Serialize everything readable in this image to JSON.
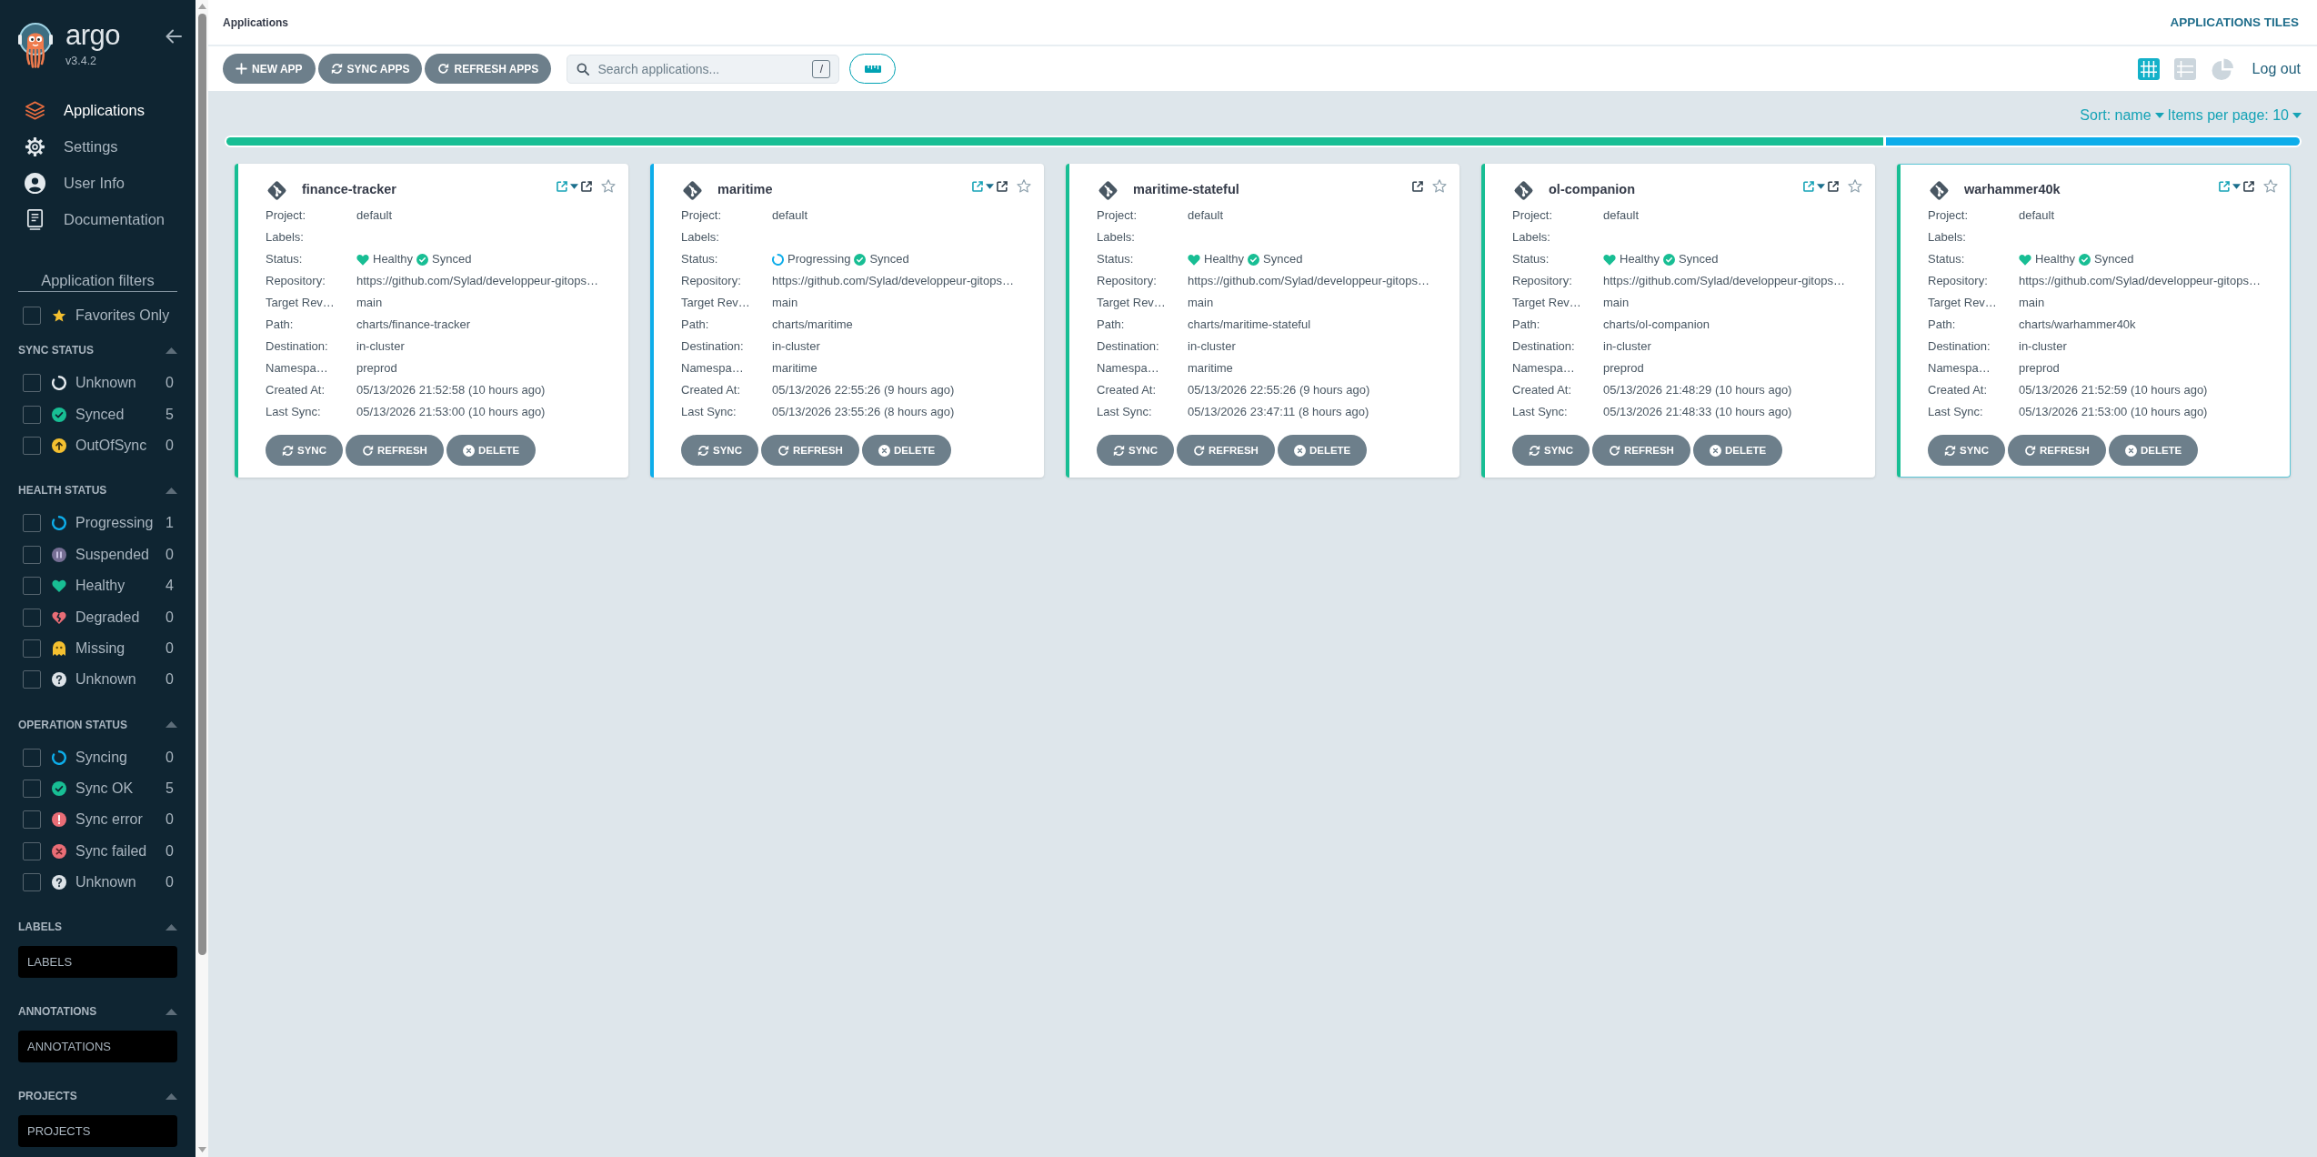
{
  "sidebar": {
    "logo": {
      "name": "argo",
      "version": "v3.4.2"
    },
    "nav": [
      {
        "kind": "applications",
        "label": "Applications",
        "selected": true
      },
      {
        "kind": "settings",
        "label": "Settings",
        "selected": false
      },
      {
        "kind": "user",
        "label": "User Info",
        "selected": false
      },
      {
        "kind": "docs",
        "label": "Documentation",
        "selected": false
      }
    ],
    "filters": {
      "title": "Application filters",
      "favorites": {
        "label": "Favorites Only",
        "checked": false
      },
      "groups": [
        {
          "kind": "checklist",
          "title": "SYNC STATUS",
          "expanded": true,
          "items": [
            {
              "kind": "sync-unknown",
              "label": "Unknown",
              "count": "0",
              "checked": false
            },
            {
              "kind": "synced",
              "label": "Synced",
              "count": "5",
              "checked": false
            },
            {
              "kind": "out-of-sync",
              "label": "OutOfSync",
              "count": "0",
              "checked": false
            }
          ]
        },
        {
          "kind": "checklist",
          "title": "HEALTH STATUS",
          "expanded": true,
          "items": [
            {
              "kind": "progressing",
              "label": "Progressing",
              "count": "1",
              "checked": false
            },
            {
              "kind": "suspended",
              "label": "Suspended",
              "count": "0",
              "checked": false
            },
            {
              "kind": "healthy",
              "label": "Healthy",
              "count": "4",
              "checked": false
            },
            {
              "kind": "degraded",
              "label": "Degraded",
              "count": "0",
              "checked": false
            },
            {
              "kind": "missing",
              "label": "Missing",
              "count": "0",
              "checked": false
            },
            {
              "kind": "health-unknown",
              "label": "Unknown",
              "count": "0",
              "checked": false
            }
          ]
        },
        {
          "kind": "checklist",
          "title": "OPERATION STATUS",
          "expanded": true,
          "items": [
            {
              "kind": "syncing",
              "label": "Syncing",
              "count": "0",
              "checked": false
            },
            {
              "kind": "sync-ok",
              "label": "Sync OK",
              "count": "5",
              "checked": false
            },
            {
              "kind": "sync-error",
              "label": "Sync error",
              "count": "0",
              "checked": false
            },
            {
              "kind": "sync-failed",
              "label": "Sync failed",
              "count": "0",
              "checked": false
            },
            {
              "kind": "operation-unknown",
              "label": "Unknown",
              "count": "0",
              "checked": false
            }
          ]
        },
        {
          "kind": "input",
          "title": "LABELS",
          "expanded": true,
          "placeholder": "LABELS"
        },
        {
          "kind": "input",
          "title": "ANNOTATIONS",
          "expanded": true,
          "placeholder": "ANNOTATIONS"
        },
        {
          "kind": "input",
          "title": "PROJECTS",
          "expanded": true,
          "placeholder": "PROJECTS"
        }
      ]
    }
  },
  "header": {
    "title": "Applications",
    "view_title": "APPLICATIONS TILES"
  },
  "toolbar": {
    "buttons": [
      {
        "kind": "add",
        "label": "NEW APP"
      },
      {
        "kind": "sync",
        "label": "SYNC APPS"
      },
      {
        "kind": "refresh",
        "label": "REFRESH APPS"
      }
    ],
    "search": {
      "placeholder": "Search applications...",
      "shortcut": "/"
    },
    "views": [
      {
        "kind": "tiles",
        "selected": true
      },
      {
        "kind": "list",
        "selected": false
      },
      {
        "kind": "summary",
        "selected": false
      }
    ],
    "logout": "Log out"
  },
  "sort": {
    "sort_label": "Sort: name",
    "page_label": "Items per page: 10"
  },
  "health_bar": [
    {
      "color": "#18be94",
      "level": 0.8
    },
    {
      "color": "#0dadea",
      "level": 0.2
    }
  ],
  "apps": [
    {
      "name": "finance-tracker",
      "links_dropdown": true,
      "favorite": false,
      "highlighted": false,
      "health": {
        "kind": "healthy",
        "label": "Healthy"
      },
      "sync": {
        "kind": "synced",
        "label": "Synced"
      },
      "fields": [
        {
          "kind": "text",
          "label": "Project:",
          "value": "default"
        },
        {
          "kind": "text",
          "label": "Labels:"
        },
        {
          "kind": "status",
          "label": "Status:"
        },
        {
          "kind": "text",
          "label": "Repository:",
          "value": "https://github.com/Sylad/developpeur-gitops…"
        },
        {
          "kind": "text",
          "label": "Target Rev…",
          "value": "main"
        },
        {
          "kind": "text",
          "label": "Path:",
          "value": "charts/finance-tracker"
        },
        {
          "kind": "text",
          "label": "Destination:",
          "value": "in-cluster"
        },
        {
          "kind": "text",
          "label": "Namespa…",
          "value": "preprod"
        },
        {
          "kind": "text",
          "label": "Created At:",
          "value": "05/13/2026 21:52:58 (10 hours ago)"
        },
        {
          "kind": "text",
          "label": "Last Sync:",
          "value": "05/13/2026 21:53:00 (10 hours ago)"
        }
      ],
      "buttons": [
        {
          "kind": "sync",
          "label": "SYNC"
        },
        {
          "kind": "refresh",
          "label": "REFRESH"
        },
        {
          "kind": "delete",
          "label": "DELETE"
        }
      ]
    },
    {
      "name": "maritime",
      "links_dropdown": true,
      "favorite": false,
      "highlighted": false,
      "health": {
        "kind": "progressing",
        "label": "Progressing"
      },
      "sync": {
        "kind": "synced",
        "label": "Synced"
      },
      "fields": [
        {
          "kind": "text",
          "label": "Project:",
          "value": "default"
        },
        {
          "kind": "text",
          "label": "Labels:"
        },
        {
          "kind": "status",
          "label": "Status:"
        },
        {
          "kind": "text",
          "label": "Repository:",
          "value": "https://github.com/Sylad/developpeur-gitops…"
        },
        {
          "kind": "text",
          "label": "Target Rev…",
          "value": "main"
        },
        {
          "kind": "text",
          "label": "Path:",
          "value": "charts/maritime"
        },
        {
          "kind": "text",
          "label": "Destination:",
          "value": "in-cluster"
        },
        {
          "kind": "text",
          "label": "Namespa…",
          "value": "maritime"
        },
        {
          "kind": "text",
          "label": "Created At:",
          "value": "05/13/2026 22:55:26 (9 hours ago)"
        },
        {
          "kind": "text",
          "label": "Last Sync:",
          "value": "05/13/2026 23:55:26 (8 hours ago)"
        }
      ],
      "buttons": [
        {
          "kind": "sync",
          "label": "SYNC"
        },
        {
          "kind": "refresh",
          "label": "REFRESH"
        },
        {
          "kind": "delete",
          "label": "DELETE"
        }
      ]
    },
    {
      "name": "maritime-stateful",
      "links_dropdown": false,
      "favorite": false,
      "highlighted": false,
      "health": {
        "kind": "healthy",
        "label": "Healthy"
      },
      "sync": {
        "kind": "synced",
        "label": "Synced"
      },
      "fields": [
        {
          "kind": "text",
          "label": "Project:",
          "value": "default"
        },
        {
          "kind": "text",
          "label": "Labels:"
        },
        {
          "kind": "status",
          "label": "Status:"
        },
        {
          "kind": "text",
          "label": "Repository:",
          "value": "https://github.com/Sylad/developpeur-gitops…"
        },
        {
          "kind": "text",
          "label": "Target Rev…",
          "value": "main"
        },
        {
          "kind": "text",
          "label": "Path:",
          "value": "charts/maritime-stateful"
        },
        {
          "kind": "text",
          "label": "Destination:",
          "value": "in-cluster"
        },
        {
          "kind": "text",
          "label": "Namespa…",
          "value": "maritime"
        },
        {
          "kind": "text",
          "label": "Created At:",
          "value": "05/13/2026 22:55:26 (9 hours ago)"
        },
        {
          "kind": "text",
          "label": "Last Sync:",
          "value": "05/13/2026 23:47:11 (8 hours ago)"
        }
      ],
      "buttons": [
        {
          "kind": "sync",
          "label": "SYNC"
        },
        {
          "kind": "refresh",
          "label": "REFRESH"
        },
        {
          "kind": "delete",
          "label": "DELETE"
        }
      ]
    },
    {
      "name": "ol-companion",
      "links_dropdown": true,
      "favorite": false,
      "highlighted": false,
      "health": {
        "kind": "healthy",
        "label": "Healthy"
      },
      "sync": {
        "kind": "synced",
        "label": "Synced"
      },
      "fields": [
        {
          "kind": "text",
          "label": "Project:",
          "value": "default"
        },
        {
          "kind": "text",
          "label": "Labels:"
        },
        {
          "kind": "status",
          "label": "Status:"
        },
        {
          "kind": "text",
          "label": "Repository:",
          "value": "https://github.com/Sylad/developpeur-gitops…"
        },
        {
          "kind": "text",
          "label": "Target Rev…",
          "value": "main"
        },
        {
          "kind": "text",
          "label": "Path:",
          "value": "charts/ol-companion"
        },
        {
          "kind": "text",
          "label": "Destination:",
          "value": "in-cluster"
        },
        {
          "kind": "text",
          "label": "Namespa…",
          "value": "preprod"
        },
        {
          "kind": "text",
          "label": "Created At:",
          "value": "05/13/2026 21:48:29 (10 hours ago)"
        },
        {
          "kind": "text",
          "label": "Last Sync:",
          "value": "05/13/2026 21:48:33 (10 hours ago)"
        }
      ],
      "buttons": [
        {
          "kind": "sync",
          "label": "SYNC"
        },
        {
          "kind": "refresh",
          "label": "REFRESH"
        },
        {
          "kind": "delete",
          "label": "DELETE"
        }
      ]
    },
    {
      "name": "warhammer40k",
      "links_dropdown": true,
      "favorite": false,
      "highlighted": true,
      "health": {
        "kind": "healthy",
        "label": "Healthy"
      },
      "sync": {
        "kind": "synced",
        "label": "Synced"
      },
      "fields": [
        {
          "kind": "text",
          "label": "Project:",
          "value": "default"
        },
        {
          "kind": "text",
          "label": "Labels:"
        },
        {
          "kind": "status",
          "label": "Status:"
        },
        {
          "kind": "text",
          "label": "Repository:",
          "value": "https://github.com/Sylad/developpeur-gitops…"
        },
        {
          "kind": "text",
          "label": "Target Rev…",
          "value": "main"
        },
        {
          "kind": "text",
          "label": "Path:",
          "value": "charts/warhammer40k"
        },
        {
          "kind": "text",
          "label": "Destination:",
          "value": "in-cluster"
        },
        {
          "kind": "text",
          "label": "Namespa…",
          "value": "preprod"
        },
        {
          "kind": "text",
          "label": "Created At:",
          "value": "05/13/2026 21:52:59 (10 hours ago)"
        },
        {
          "kind": "text",
          "label": "Last Sync:",
          "value": "05/13/2026 21:53:00 (10 hours ago)"
        }
      ],
      "buttons": [
        {
          "kind": "sync",
          "label": "SYNC"
        },
        {
          "kind": "refresh",
          "label": "REFRESH"
        },
        {
          "kind": "delete",
          "label": "DELETE"
        }
      ]
    }
  ]
}
